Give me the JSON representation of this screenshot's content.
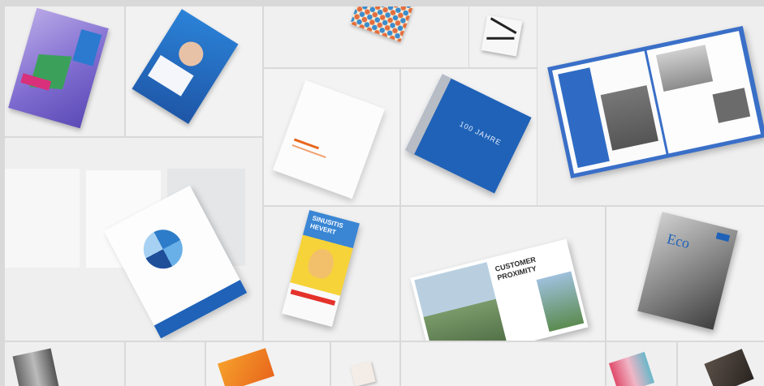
{
  "colors": {
    "page_bg": "#d9d9da",
    "tile_light": "#eeeeef",
    "tile_white": "#f3f3f4",
    "brand_blue": "#1f62b8",
    "orange": "#e8661c",
    "yellow": "#f3c821"
  },
  "mosaic": {
    "tile_count": 20
  },
  "texts": {
    "anniversary_book_title": "100 JAHRE",
    "pharma_pack_line1": "SINUSITIS",
    "pharma_pack_line2": "HEVERT",
    "magazine_headline_line1": "CUSTOMER",
    "magazine_headline_line2": "PROXIMITY",
    "eco_magazine_title": "Eco"
  }
}
